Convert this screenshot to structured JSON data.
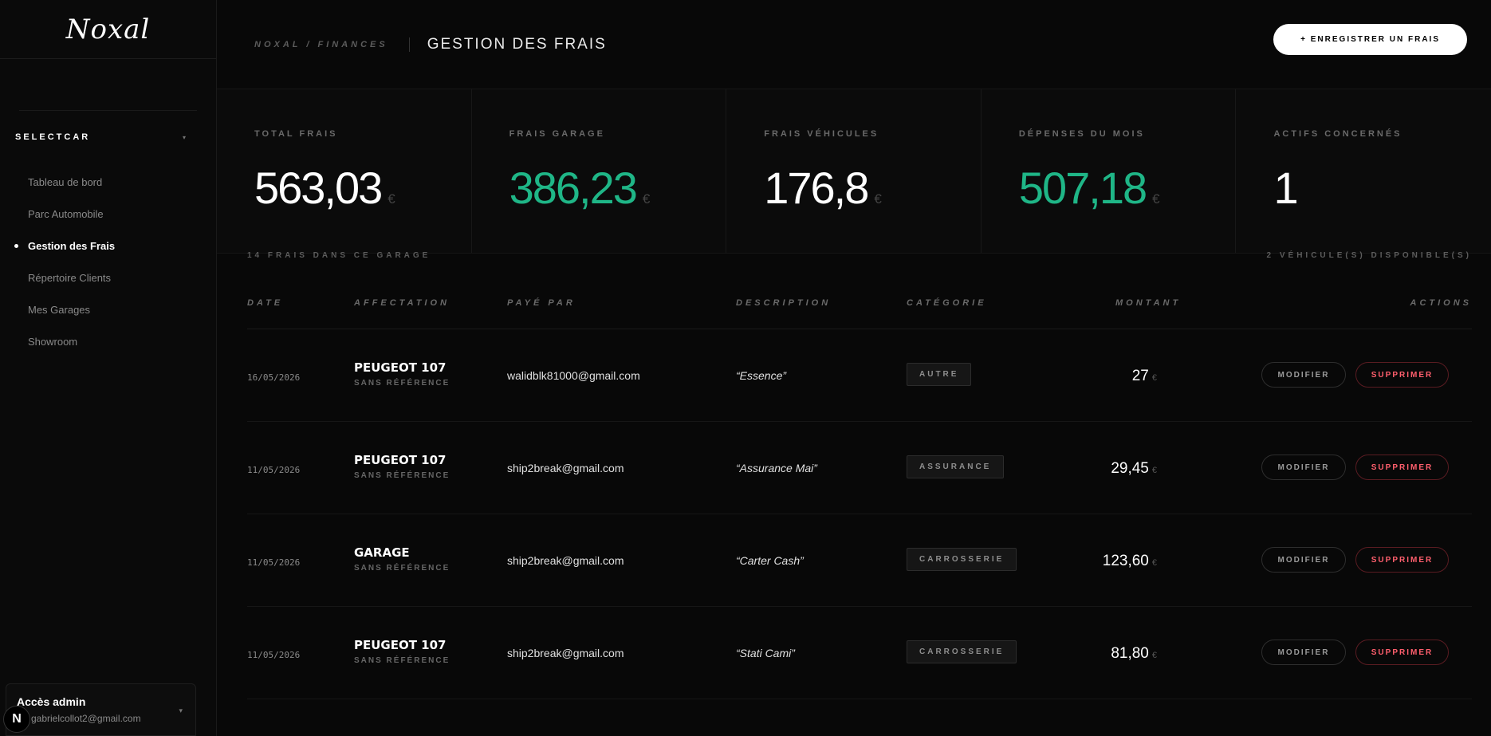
{
  "brand": {
    "logo_text": "Noxal"
  },
  "workspace": {
    "name": "SELECTCAR",
    "caret": "▾"
  },
  "nav": {
    "items": [
      {
        "label": "Tableau de bord",
        "active": false
      },
      {
        "label": "Parc Automobile",
        "active": false
      },
      {
        "label": "Gestion des Frais",
        "active": true
      },
      {
        "label": "Répertoire Clients",
        "active": false
      },
      {
        "label": "Mes Garages",
        "active": false
      },
      {
        "label": "Showroom",
        "active": false
      }
    ]
  },
  "admin": {
    "title": "Accès admin",
    "email": "gabrielcollot2@gmail.com",
    "caret": "▾",
    "badge": "N"
  },
  "header": {
    "breadcrumb": "NOXAL / FINANCES",
    "title": "GESTION DES FRAIS",
    "add_button": "+ ENREGISTRER UN FRAIS"
  },
  "stats": [
    {
      "label": "TOTAL FRAIS",
      "value": "563,03",
      "currency": "€",
      "color": "#ffffff"
    },
    {
      "label": "FRAIS GARAGE",
      "value": "386,23",
      "currency": "€",
      "color": "#1fb687"
    },
    {
      "label": "FRAIS VÉHICULES",
      "value": "176,8",
      "currency": "€",
      "color": "#ffffff"
    },
    {
      "label": "DÉPENSES DU MOIS",
      "value": "507,18",
      "currency": "€",
      "color": "#1fb687"
    },
    {
      "label": "ACTIFS CONCERNÉS",
      "value": "1",
      "currency": "",
      "color": "#ffffff"
    }
  ],
  "list_meta": {
    "count": "14 FRAIS DANS CE GARAGE",
    "available": "2 VÉHICULE(S) DISPONIBLE(S)"
  },
  "table": {
    "headers": {
      "date": "DATE",
      "affectation": "AFFECTATION",
      "paid_by": "PAYÉ PAR",
      "description": "DESCRIPTION",
      "category": "CATÉGORIE",
      "amount": "MONTANT",
      "actions": "ACTIONS"
    },
    "edit_label": "MODIFIER",
    "delete_label": "SUPPRIMER",
    "rows": [
      {
        "date": "16/05/2026",
        "asset": "PEUGEOT 107",
        "ref": "SANS RÉFÉRENCE",
        "payer": "walidblk81000@gmail.com",
        "description": "“Essence”",
        "category": "AUTRE",
        "amount": "27",
        "currency": "€"
      },
      {
        "date": "11/05/2026",
        "asset": "PEUGEOT 107",
        "ref": "SANS RÉFÉRENCE",
        "payer": "ship2break@gmail.com",
        "description": "“Assurance Mai”",
        "category": "ASSURANCE",
        "amount": "29,45",
        "currency": "€"
      },
      {
        "date": "11/05/2026",
        "asset": "GARAGE",
        "ref": "SANS RÉFÉRENCE",
        "payer": "ship2break@gmail.com",
        "description": "“Carter Cash”",
        "category": "CARROSSERIE",
        "amount": "123,60",
        "currency": "€"
      },
      {
        "date": "11/05/2026",
        "asset": "PEUGEOT 107",
        "ref": "SANS RÉFÉRENCE",
        "payer": "ship2break@gmail.com",
        "description": "“Stati Cami”",
        "category": "CARROSSERIE",
        "amount": "81,80",
        "currency": "€"
      }
    ]
  }
}
